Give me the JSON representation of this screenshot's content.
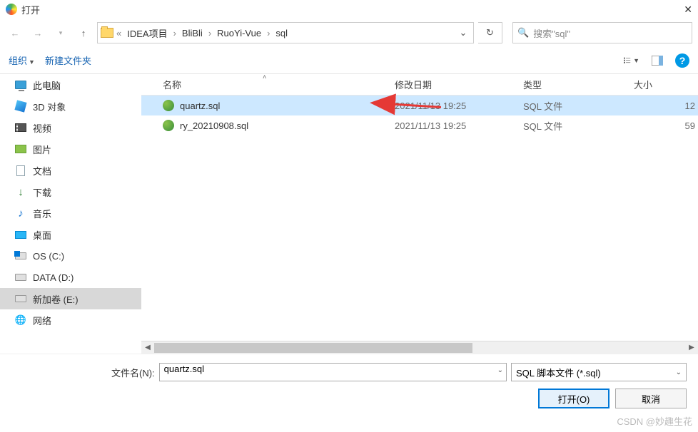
{
  "window": {
    "title": "打开"
  },
  "breadcrumb": {
    "root_sep": "«",
    "items": [
      "IDEA项目",
      "BliBli",
      "RuoYi-Vue",
      "sql"
    ]
  },
  "search": {
    "placeholder": "搜索\"sql\""
  },
  "toolbar": {
    "organize": "组织",
    "newfolder": "新建文件夹"
  },
  "sidebar": {
    "items": [
      {
        "label": "此电脑",
        "icon": "pc"
      },
      {
        "label": "3D 对象",
        "icon": "3d"
      },
      {
        "label": "视频",
        "icon": "vid"
      },
      {
        "label": "图片",
        "icon": "img"
      },
      {
        "label": "文档",
        "icon": "doc"
      },
      {
        "label": "下载",
        "icon": "dl"
      },
      {
        "label": "音乐",
        "icon": "mus"
      },
      {
        "label": "桌面",
        "icon": "desk"
      },
      {
        "label": "OS (C:)",
        "icon": "drive-os"
      },
      {
        "label": "DATA (D:)",
        "icon": "drive"
      },
      {
        "label": "新加卷 (E:)",
        "icon": "drive",
        "selected": true
      },
      {
        "label": "网络",
        "icon": "net"
      }
    ]
  },
  "columns": {
    "name": "名称",
    "date": "修改日期",
    "type": "类型",
    "size": "大小"
  },
  "files": [
    {
      "name": "quartz.sql",
      "date": "2021/11/13 19:25",
      "type": "SQL 文件",
      "size": "12",
      "selected": true
    },
    {
      "name": "ry_20210908.sql",
      "date": "2021/11/13 19:25",
      "type": "SQL 文件",
      "size": "59"
    }
  ],
  "footer": {
    "filename_label": "文件名(N):",
    "filename_value": "quartz.sql",
    "filetype_value": "SQL 脚本文件 (*.sql)",
    "open": "打开(O)",
    "cancel": "取消"
  },
  "watermark": "CSDN @妙趣生花"
}
